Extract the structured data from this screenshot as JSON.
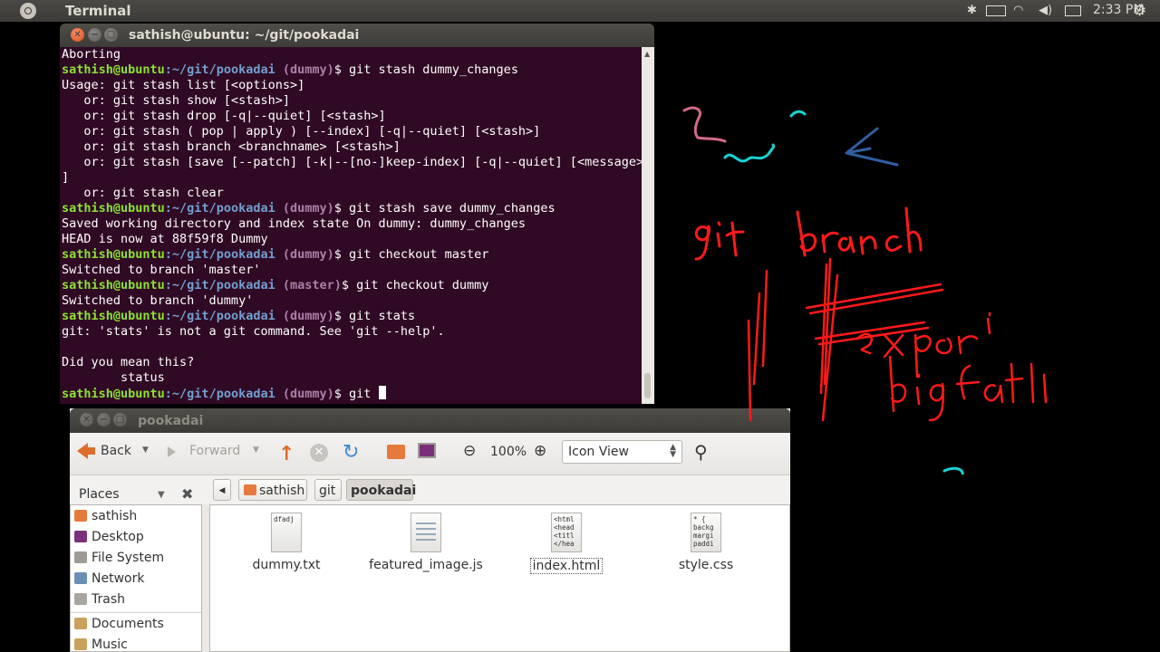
{
  "top_panel": {
    "app_name": "Terminal",
    "clock": "2:33 PM"
  },
  "terminal": {
    "title": "sathish@ubuntu: ~/git/pookadai",
    "user_host": "sathish@ubuntu",
    "path": ":~/git/pookadai",
    "branch_dummy": " (dummy)",
    "branch_master": " (master)",
    "lines": {
      "l0": "Aborting",
      "c1": "$ git stash dummy_changes",
      "l2": "Usage: git stash list [<options>]",
      "l3": "   or: git stash show [<stash>]",
      "l4": "   or: git stash drop [-q|--quiet] [<stash>]",
      "l5": "   or: git stash ( pop | apply ) [--index] [-q|--quiet] [<stash>]",
      "l6": "   or: git stash branch <branchname> [<stash>]",
      "l7": "   or: git stash [save [--patch] [-k|--[no-]keep-index] [-q|--quiet] [<message>]",
      "l8": "]",
      "l9": "   or: git stash clear",
      "c10": "$ git stash save dummy_changes",
      "l11": "Saved working directory and index state On dummy: dummy_changes",
      "l12": "HEAD is now at 88f59f8 Dummy",
      "c13": "$ git checkout master",
      "l14": "Switched to branch 'master'",
      "c15": "$ git checkout dummy",
      "l16": "Switched to branch 'dummy'",
      "c17": "$ git stats",
      "l18": "git: 'stats' is not a git command. See 'git --help'.",
      "l19": "",
      "l20": "Did you mean this?",
      "l21": "        status",
      "c22": "$ git "
    }
  },
  "file_manager": {
    "title": "pookadai",
    "toolbar": {
      "back": "Back",
      "forward": "Forward",
      "zoom": "100%",
      "view": "Icon View"
    },
    "places_label": "Places",
    "breadcrumbs": [
      "sathish",
      "git",
      "pookadai"
    ],
    "sidebar": [
      {
        "label": "sathish",
        "color": "#e57a3c"
      },
      {
        "label": "Desktop",
        "color": "#7b2f7a"
      },
      {
        "label": "File System",
        "color": "#9e9b95"
      },
      {
        "label": "Network",
        "color": "#6a8fb5"
      },
      {
        "label": "Trash",
        "color": "#a8a59f"
      },
      {
        "label": "Documents",
        "color": "#c9a15a"
      },
      {
        "label": "Music",
        "color": "#c9a15a"
      }
    ],
    "files": [
      {
        "name": "dummy.txt",
        "preview": "dfadj"
      },
      {
        "name": "featured_image.js",
        "preview": ""
      },
      {
        "name": "index.html",
        "preview": "<html\n<head\n<titl\n</hea"
      },
      {
        "name": "style.css",
        "preview": "* {\nbackg\nmargi\npaddi"
      }
    ]
  },
  "annotation": {
    "color_red": "#ff1a1a",
    "color_cyan": "#19d3d3",
    "color_pink": "#d46a8a",
    "color_blue": "#2f5fa0"
  }
}
